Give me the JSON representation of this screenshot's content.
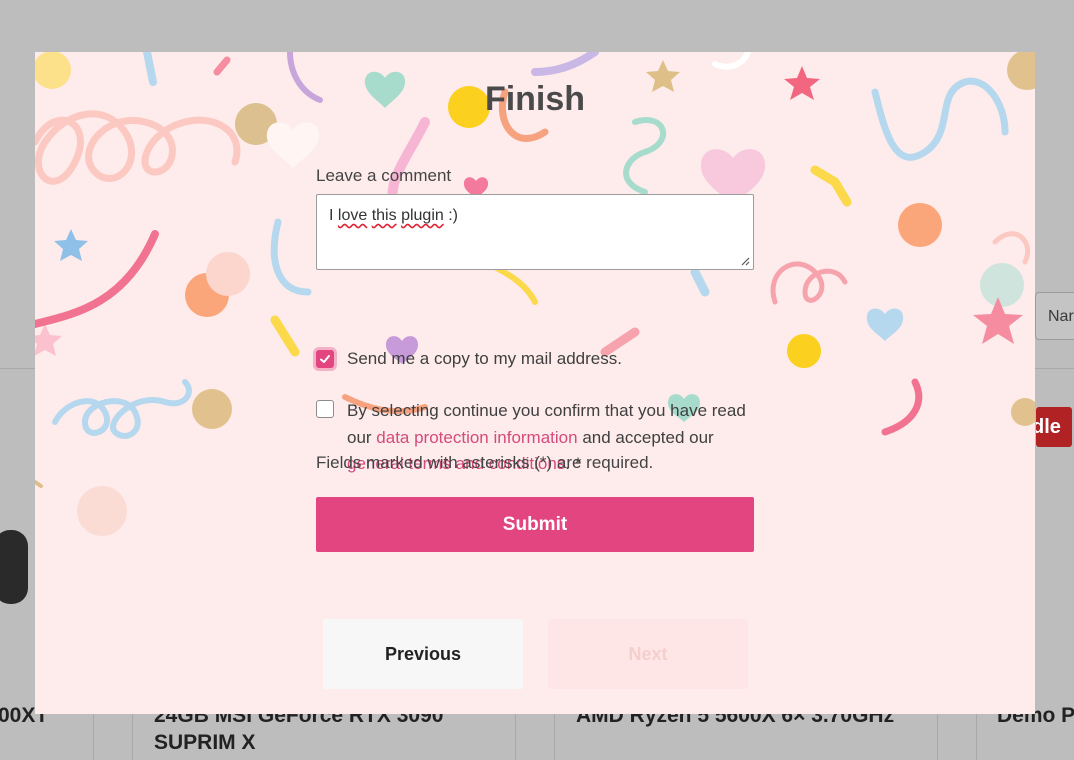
{
  "background": {
    "select_text": "Nar",
    "badge_text": "dle",
    "product_titles": [
      "00XT",
      "24GB MSI GeForce RTX 3090 SUPRIM X",
      "AMD Ryzen 5 5600X 6×  3.70GHz",
      "Demo P"
    ]
  },
  "modal": {
    "title": "Finish",
    "comment": {
      "label": "Leave a comment",
      "value_prefix": "I ",
      "value_word1": "love",
      "value_word2": "this",
      "value_word3": "plugin",
      "value_suffix": " :)"
    },
    "copy_checkbox": {
      "checked": true,
      "label": "Send me a copy to my mail address."
    },
    "consent_checkbox": {
      "checked": false,
      "text_before": "By selecting continue you confirm that you have read our ",
      "link1": "data protection information",
      "text_middle": " and accepted our ",
      "link2": "general terms and conditions",
      "text_after": ". *"
    },
    "required_note": "Fields marked with asterisks (*) are required.",
    "submit_label": "Submit",
    "previous_label": "Previous",
    "next_label": "Next"
  },
  "colors": {
    "accent": "#e2457f",
    "modal_background": "#fdeceb",
    "link": "#d64a7d"
  }
}
